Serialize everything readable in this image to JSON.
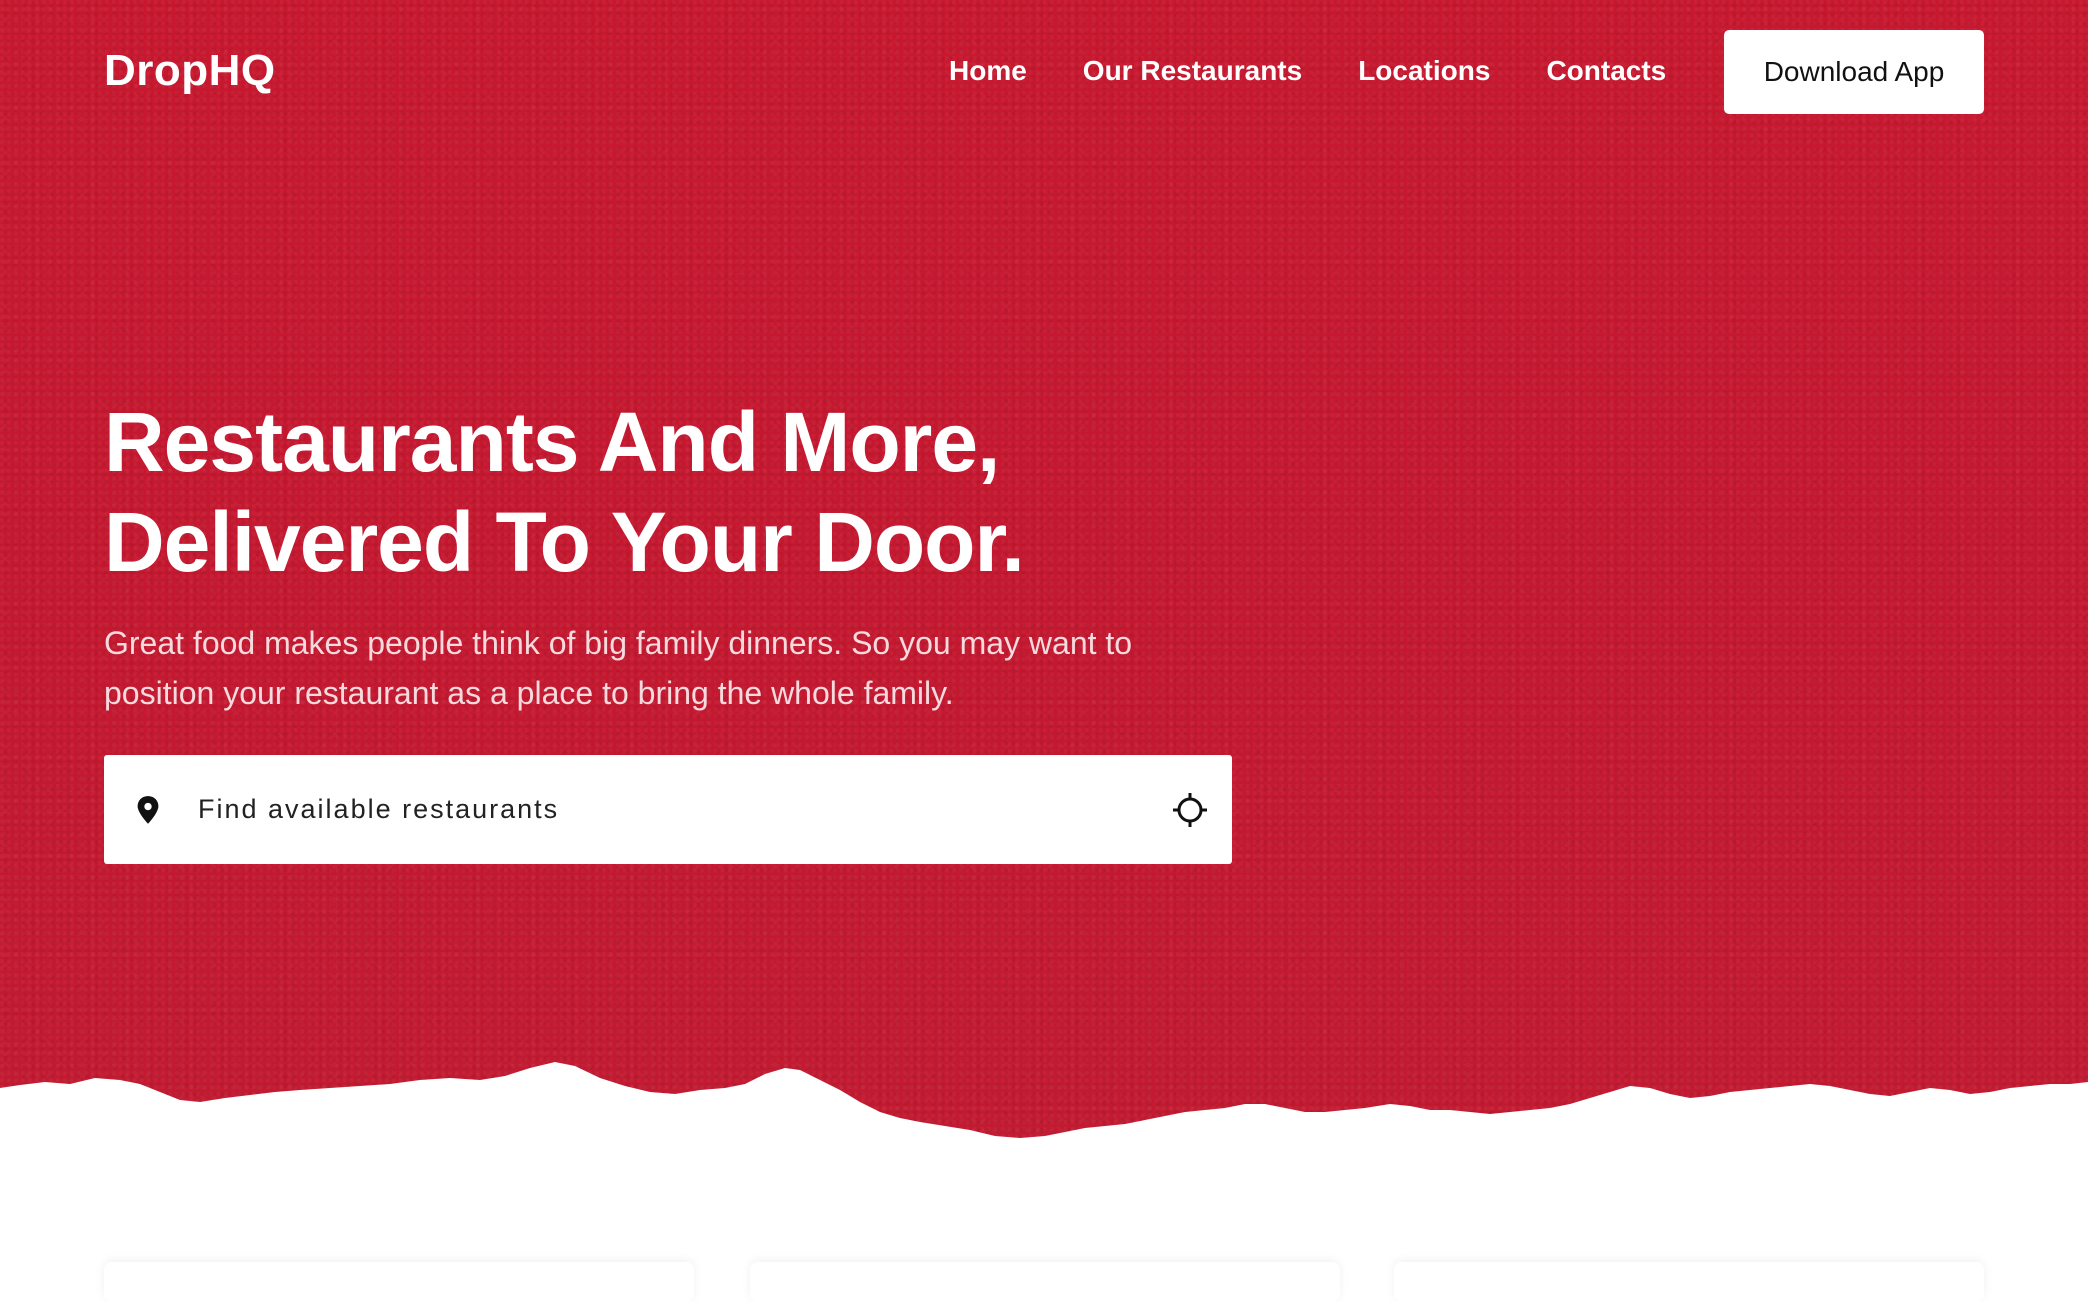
{
  "brand": {
    "logo": "DropHQ",
    "accent_color": "#c8192f"
  },
  "nav": {
    "items": [
      {
        "label": "Home"
      },
      {
        "label": "Our Restaurants"
      },
      {
        "label": "Locations"
      },
      {
        "label": "Contacts"
      }
    ],
    "cta_label": "Download App"
  },
  "hero": {
    "headline_line1": "Restaurants And More,",
    "headline_line2": "Delivered To Your Door.",
    "subtext": "Great food makes people think of big family dinners. So you may want to position your restaurant as a place to bring the whole family."
  },
  "search": {
    "placeholder": "Find available restaurants",
    "value": "",
    "left_icon": "map-pin-icon",
    "right_icon": "locate-crosshair-icon"
  }
}
